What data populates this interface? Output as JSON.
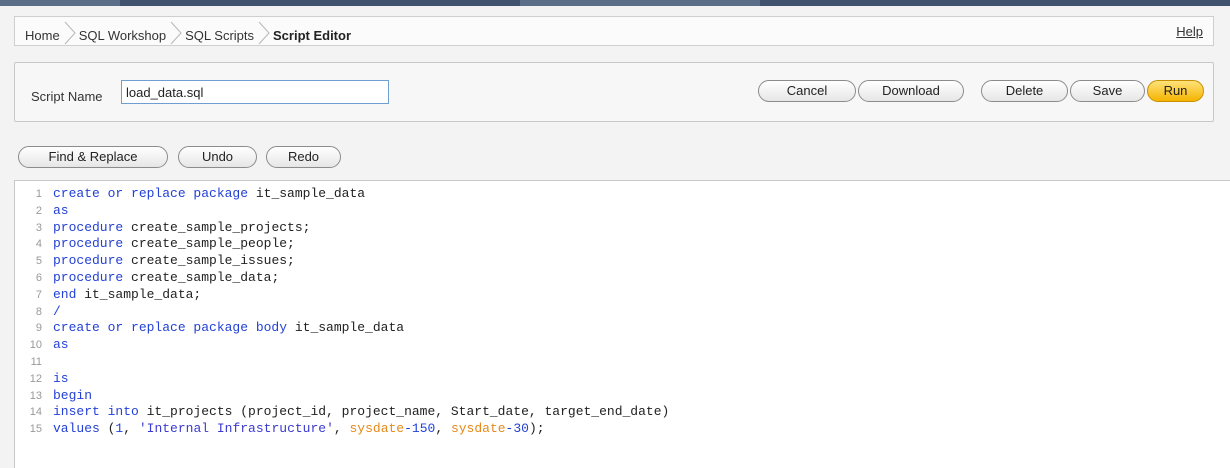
{
  "breadcrumb": {
    "items": [
      "Home",
      "SQL Workshop",
      "SQL Scripts",
      "Script Editor"
    ],
    "help_label": "Help"
  },
  "script": {
    "name_label": "Script Name",
    "name_value": "load_data.sql"
  },
  "actions": {
    "cancel": "Cancel",
    "download": "Download",
    "delete": "Delete",
    "save": "Save",
    "run": "Run"
  },
  "tools": {
    "find_replace": "Find & Replace",
    "undo": "Undo",
    "redo": "Redo"
  },
  "colors": {
    "keyword": "#2341d6",
    "function": "#e68a1a",
    "run_button": "#f5b400"
  },
  "code_lines": [
    [
      [
        "kw",
        "create or replace package"
      ],
      [
        "t",
        " it_sample_data"
      ]
    ],
    [
      [
        "kw",
        "as"
      ]
    ],
    [
      [
        "kw",
        "procedure"
      ],
      [
        "t",
        " create_sample_projects;"
      ]
    ],
    [
      [
        "kw",
        "procedure"
      ],
      [
        "t",
        " create_sample_people;"
      ]
    ],
    [
      [
        "kw",
        "procedure"
      ],
      [
        "t",
        " create_sample_issues;"
      ]
    ],
    [
      [
        "kw",
        "procedure"
      ],
      [
        "t",
        " create_sample_data;"
      ]
    ],
    [
      [
        "kw",
        "end"
      ],
      [
        "t",
        " it_sample_data;"
      ]
    ],
    [
      [
        "kw",
        "/"
      ]
    ],
    [
      [
        "kw",
        "create or replace package body"
      ],
      [
        "t",
        " it_sample_data"
      ]
    ],
    [
      [
        "kw",
        "as"
      ]
    ],
    [],
    [
      [
        "kw",
        "is"
      ]
    ],
    [
      [
        "kw",
        "begin"
      ]
    ],
    [
      [
        "kw",
        "insert into"
      ],
      [
        "t",
        " it_projects (project_id, project_name, Start_date, target_end_date)"
      ]
    ],
    [
      [
        "kw",
        "values"
      ],
      [
        "t",
        " ("
      ],
      [
        "num",
        "1"
      ],
      [
        "t",
        ", "
      ],
      [
        "str",
        "'Internal Infrastructure'"
      ],
      [
        "t",
        ", "
      ],
      [
        "fn",
        "sysdate"
      ],
      [
        "num",
        "-150"
      ],
      [
        "t",
        ", "
      ],
      [
        "fn",
        "sysdate"
      ],
      [
        "num",
        "-30"
      ],
      [
        "t",
        ");"
      ]
    ]
  ]
}
